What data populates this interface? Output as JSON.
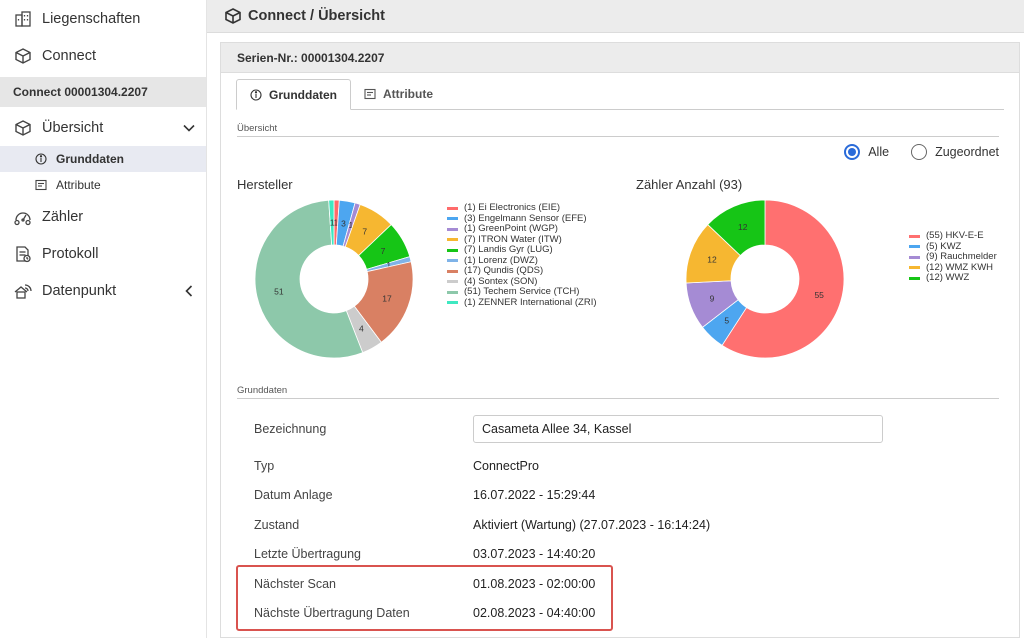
{
  "sidebar": {
    "liegenschaften": "Liegenschaften",
    "connect": "Connect",
    "connect_header": "Connect 00001304.2207",
    "uebersicht": "Übersicht",
    "grunddaten": "Grunddaten",
    "attribute": "Attribute",
    "zaehler": "Zähler",
    "protokoll": "Protokoll",
    "datenpunkt": "Datenpunkt"
  },
  "header": {
    "title": "Connect / Übersicht"
  },
  "card": {
    "serial": "Serien-Nr.: 00001304.2207",
    "tabs": [
      "Grunddaten",
      "Attribute"
    ],
    "overview_label": "Übersicht",
    "radios": [
      "Alle",
      "Zugeordnet"
    ],
    "selected_radio": "Alle"
  },
  "chart_data": [
    {
      "type": "pie",
      "title": "Hersteller",
      "donut": true,
      "categories": [
        "(1) Ei Electronics (EIE)",
        "(3) Engelmann Sensor (EFE)",
        "(1) GreenPoint (WGP)",
        "(7) ITRON Water (ITW)",
        "(7) Landis Gyr (LUG)",
        "(1) Lorenz (DWZ)",
        "(17) Qundis (QDS)",
        "(4) Sontex (SON)",
        "(51) Techem Service (TCH)",
        "(1) ZENNER International (ZRI)"
      ],
      "values": [
        1,
        3,
        1,
        7,
        7,
        1,
        17,
        4,
        51,
        1
      ],
      "colors": [
        "#ff6b6b",
        "#4da6f0",
        "#a58bd4",
        "#f6b731",
        "#16c516",
        "#7fb3e8",
        "#d98063",
        "#cccccc",
        "#8dc8aa",
        "#3ee8c1"
      ],
      "labels": [
        "1",
        "3",
        "1",
        "7",
        "7",
        "1",
        "17",
        "4",
        "51",
        "1"
      ]
    },
    {
      "type": "pie",
      "title": "Zähler Anzahl (93)",
      "donut": true,
      "categories": [
        "(55) HKV-E-E",
        "(5) KWZ",
        "(9) Rauchmelder",
        "(12) WMZ KWH",
        "(12) WWZ"
      ],
      "values": [
        55,
        5,
        9,
        12,
        12
      ],
      "colors": [
        "#ff7070",
        "#4da6f0",
        "#a58bd4",
        "#f6b731",
        "#16c516"
      ],
      "labels": [
        "55",
        "5",
        "9",
        "12",
        "12"
      ]
    }
  ],
  "grunddaten": {
    "section_label": "Grunddaten",
    "bezeichnung_label": "Bezeichnung",
    "bezeichnung_value": "Casameta Allee 34, Kassel",
    "typ_label": "Typ",
    "typ_value": "ConnectPro",
    "datum_label": "Datum Anlage",
    "datum_value": "16.07.2022 - 15:29:44",
    "zustand_label": "Zustand",
    "zustand_value": "Aktiviert (Wartung) (27.07.2023 - 16:14:24)",
    "letzte_label": "Letzte Übertragung",
    "letzte_value": "03.07.2023 - 14:40:20",
    "scan_label": "Nächster Scan",
    "scan_value": "01.08.2023 - 02:00:00",
    "naechste_label": "Nächste Übertragung Daten",
    "naechste_value": "02.08.2023 - 04:40:00"
  }
}
